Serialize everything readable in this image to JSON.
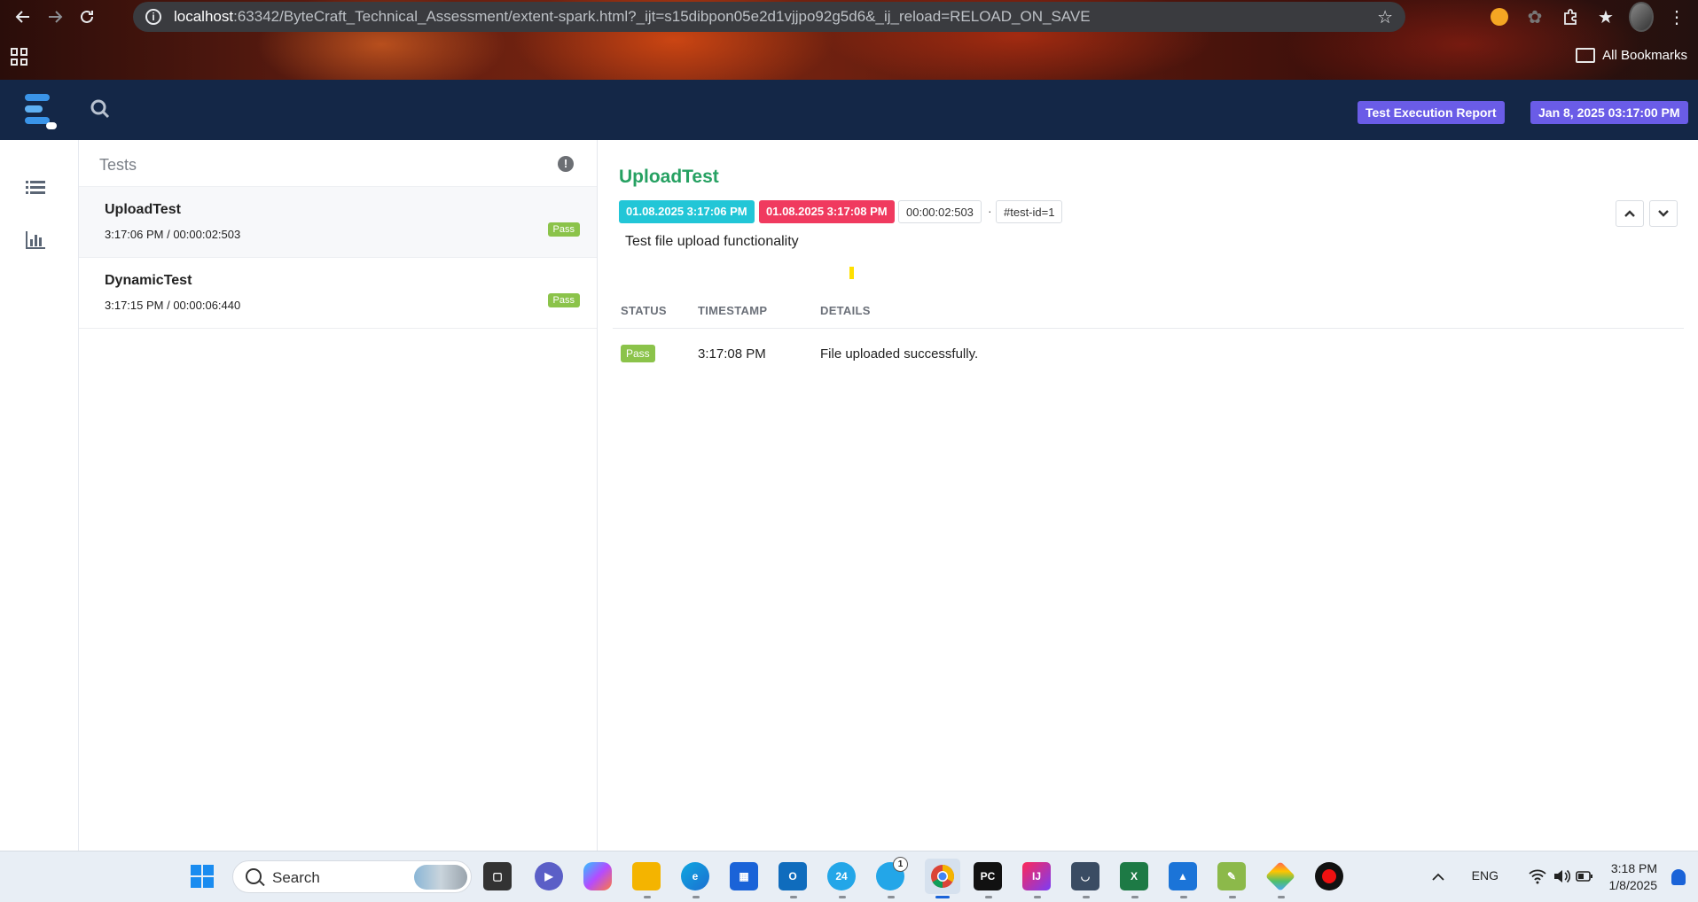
{
  "browser": {
    "url_host": "localhost",
    "url_path": ":63342/ByteCraft_Technical_Assessment/extent-spark.html?_ijt=s15dibpon05e2d1vjjpo92g5d6&_ij_reload=RELOAD_ON_SAVE",
    "bookmarks_label": "All Bookmarks"
  },
  "header": {
    "report_name": "Test Execution Report",
    "report_date": "Jan 8, 2025 03:17:00 PM",
    "colors": {
      "navbar": "#142747",
      "badge": "#6a5ce7"
    }
  },
  "tests_panel": {
    "title": "Tests",
    "items": [
      {
        "name": "UploadTest",
        "meta": "3:17:06 PM / 00:00:02:503",
        "status": "Pass"
      },
      {
        "name": "DynamicTest",
        "meta": "3:17:15 PM / 00:00:06:440",
        "status": "Pass"
      }
    ]
  },
  "detail": {
    "name": "UploadTest",
    "start_time": "01.08.2025 3:17:06 PM",
    "end_time": "01.08.2025 3:17:08 PM",
    "duration": "00:00:02:503",
    "separator": "·",
    "test_id": "#test-id=1",
    "description": "Test file upload functionality",
    "columns": [
      "STATUS",
      "TIMESTAMP",
      "DETAILS"
    ],
    "logs": [
      {
        "status": "Pass",
        "timestamp": "3:17:08 PM",
        "details": "File uploaded successfully."
      }
    ],
    "colors": {
      "title": "#26a162",
      "start": "#22c6d7",
      "end": "#f03a5f",
      "pass": "#8bc34a"
    }
  },
  "taskbar": {
    "search_label": "Search",
    "language": "ENG",
    "time": "3:18 PM",
    "date": "1/8/2025",
    "badge_count": "1",
    "calendar_day": "24"
  }
}
